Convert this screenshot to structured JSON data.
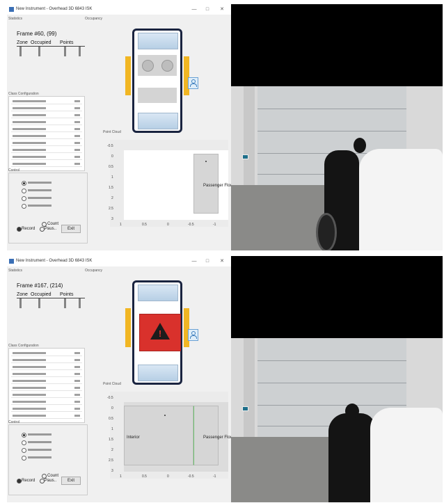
{
  "panels": [
    {
      "window_title": "New Instrument - Overhead 3D 6843 ISK",
      "controls": [
        "—",
        "□",
        "✕"
      ],
      "statistics_label": "Statistics",
      "occupancy_label": "Occupancy",
      "frame_title": "Frame #60, (99)",
      "zone_headers": [
        "Zone",
        "Occupied",
        "Points"
      ],
      "config_label": "Class Configuration",
      "control_label": "Control",
      "point_cloud_label": "Point Cloud",
      "count_label": "Count",
      "record_label": "Record",
      "pause_label": "Paus..",
      "exit_label": "Exit",
      "zone_label": "Passenger Floor",
      "y_ticks": [
        "-0.5",
        "0",
        "0.5",
        "1",
        "1.5",
        "2",
        "2.5",
        "3"
      ],
      "x_ticks": [
        "1",
        "0.5",
        "0",
        "-0.5",
        "-1"
      ],
      "state": "normal"
    },
    {
      "window_title": "New Instrument - Overhead 3D 6843 ISK",
      "controls": [
        "—",
        "□",
        "✕"
      ],
      "statistics_label": "Statistics",
      "occupancy_label": "Occupancy",
      "frame_title": "Frame #167, (214)",
      "zone_headers": [
        "Zone",
        "Occupied",
        "Points"
      ],
      "config_label": "Class Configuration",
      "control_label": "Control",
      "point_cloud_label": "Point Cloud",
      "count_label": "Count",
      "record_label": "Record",
      "pause_label": "Paus..",
      "exit_label": "Exit",
      "interior_label": "Interior",
      "zone_label": "Passenger Floor",
      "y_ticks": [
        "-0.5",
        "0",
        "0.5",
        "1",
        "1.5",
        "2",
        "2.5",
        "3"
      ],
      "x_ticks": [
        "1",
        "0.5",
        "0",
        "-0.5",
        "-1"
      ],
      "state": "alert"
    }
  ],
  "colors": {
    "door_accent": "#f1b623",
    "alert_red": "#d9312c",
    "car_outline": "#1a2440",
    "person_badge": "#6aa1d4"
  },
  "icons": [
    "app-icon",
    "minimize-icon",
    "maximize-icon",
    "close-icon",
    "warning-triangle-icon",
    "person-badge-icon"
  ]
}
